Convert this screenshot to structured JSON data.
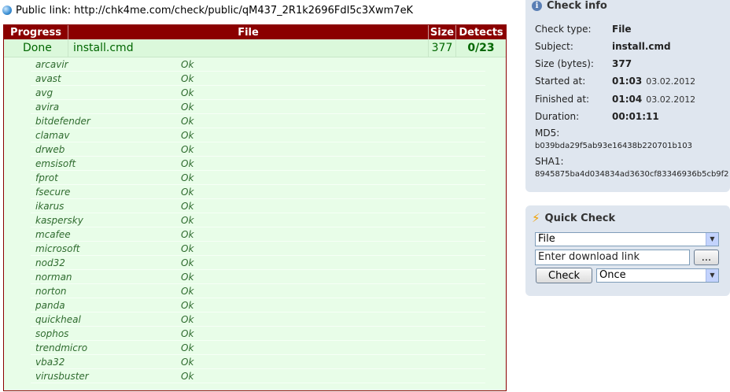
{
  "public_link": {
    "label": "Public link:",
    "url": "http://chk4me.com/check/public/qM437_2R1k2696FdI5c3Xwm7eK"
  },
  "results": {
    "headers": {
      "progress": "Progress",
      "file": "File",
      "size": "Size",
      "detects": "Detects"
    },
    "main_row": {
      "progress": "Done",
      "file": "install.cmd",
      "size": "377",
      "detects": "0/23"
    },
    "engines": [
      {
        "name": "arcavir",
        "result": "Ok"
      },
      {
        "name": "avast",
        "result": "Ok"
      },
      {
        "name": "avg",
        "result": "Ok"
      },
      {
        "name": "avira",
        "result": "Ok"
      },
      {
        "name": "bitdefender",
        "result": "Ok"
      },
      {
        "name": "clamav",
        "result": "Ok"
      },
      {
        "name": "drweb",
        "result": "Ok"
      },
      {
        "name": "emsisoft",
        "result": "Ok"
      },
      {
        "name": "fprot",
        "result": "Ok"
      },
      {
        "name": "fsecure",
        "result": "Ok"
      },
      {
        "name": "ikarus",
        "result": "Ok"
      },
      {
        "name": "kaspersky",
        "result": "Ok"
      },
      {
        "name": "mcafee",
        "result": "Ok"
      },
      {
        "name": "microsoft",
        "result": "Ok"
      },
      {
        "name": "nod32",
        "result": "Ok"
      },
      {
        "name": "norman",
        "result": "Ok"
      },
      {
        "name": "norton",
        "result": "Ok"
      },
      {
        "name": "panda",
        "result": "Ok"
      },
      {
        "name": "quickheal",
        "result": "Ok"
      },
      {
        "name": "sophos",
        "result": "Ok"
      },
      {
        "name": "trendmicro",
        "result": "Ok"
      },
      {
        "name": "vba32",
        "result": "Ok"
      },
      {
        "name": "virusbuster",
        "result": "Ok"
      }
    ]
  },
  "check_info": {
    "title": "Check info",
    "check_type_label": "Check type:",
    "check_type": "File",
    "subject_label": "Subject:",
    "subject": "install.cmd",
    "size_label": "Size (bytes):",
    "size": "377",
    "started_label": "Started at:",
    "started_time": "01:03",
    "started_date": "03.02.2012",
    "finished_label": "Finished at:",
    "finished_time": "01:04",
    "finished_date": "03.02.2012",
    "duration_label": "Duration:",
    "duration": "00:01:11",
    "md5_label": "MD5:",
    "md5": "b039bda29f5ab93e16438b220701b103",
    "sha1_label": "SHA1:",
    "sha1": "8945875ba4d034834ad3630cf83346936b5cb9f2"
  },
  "quick_check": {
    "title": "Quick Check",
    "type_selected": "File",
    "link_placeholder": "Enter download link",
    "browse_label": "...",
    "check_label": "Check",
    "frequency_selected": "Once"
  },
  "colors": {
    "header_bg": "#8b0000",
    "row_bg": "#e8fde8",
    "ok_text": "#2f6b2f",
    "panel_bg": "#dfe6ef"
  }
}
